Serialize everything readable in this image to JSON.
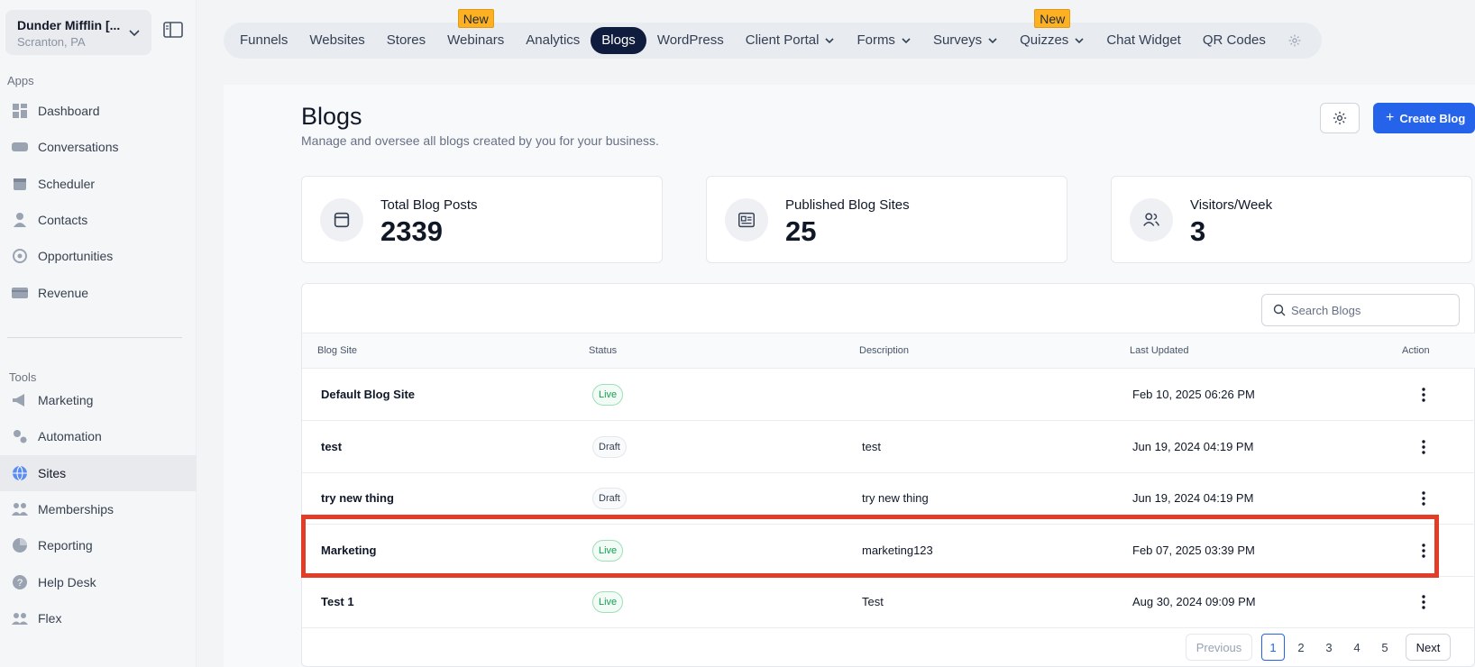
{
  "account": {
    "name": "Dunder Mifflin [...",
    "location": "Scranton, PA"
  },
  "sidebar": {
    "apps_label": "Apps",
    "tools_label": "Tools",
    "apps": [
      {
        "label": "Dashboard",
        "icon": "dashboard-icon"
      },
      {
        "label": "Conversations",
        "icon": "chat-icon"
      },
      {
        "label": "Scheduler",
        "icon": "calendar-icon"
      },
      {
        "label": "Contacts",
        "icon": "person-icon"
      },
      {
        "label": "Opportunities",
        "icon": "target-icon"
      },
      {
        "label": "Revenue",
        "icon": "card-icon"
      }
    ],
    "tools": [
      {
        "label": "Marketing",
        "icon": "megaphone-icon"
      },
      {
        "label": "Automation",
        "icon": "gears-icon"
      },
      {
        "label": "Sites",
        "icon": "globe-icon",
        "active": true
      },
      {
        "label": "Memberships",
        "icon": "people-icon"
      },
      {
        "label": "Reporting",
        "icon": "pie-icon"
      },
      {
        "label": "Help Desk",
        "icon": "help-icon"
      },
      {
        "label": "Flex",
        "icon": "group-icon"
      }
    ]
  },
  "topnav": {
    "tabs": [
      {
        "label": "Funnels"
      },
      {
        "label": "Websites"
      },
      {
        "label": "Stores"
      },
      {
        "label": "Webinars",
        "badge": "New"
      },
      {
        "label": "Analytics"
      },
      {
        "label": "Blogs",
        "active": true
      },
      {
        "label": "WordPress"
      },
      {
        "label": "Client Portal",
        "dropdown": true
      },
      {
        "label": "Forms",
        "dropdown": true
      },
      {
        "label": "Surveys",
        "dropdown": true
      },
      {
        "label": "Quizzes",
        "dropdown": true,
        "badge": "New"
      },
      {
        "label": "Chat Widget"
      },
      {
        "label": "QR Codes"
      }
    ]
  },
  "page": {
    "title": "Blogs",
    "subtitle": "Manage and oversee all blogs created by you for your business.",
    "create_label": "Create Blog"
  },
  "stats": [
    {
      "label": "Total Blog Posts",
      "value": "2339",
      "icon": "calendar-page-icon"
    },
    {
      "label": "Published Blog Sites",
      "value": "25",
      "icon": "article-icon"
    },
    {
      "label": "Visitors/Week",
      "value": "3",
      "icon": "users-icon"
    }
  ],
  "table": {
    "search_placeholder": "Search Blogs",
    "columns": [
      "Blog Site",
      "Status",
      "Description",
      "Last Updated",
      "Action"
    ],
    "rows": [
      {
        "site": "Default Blog Site",
        "status": "Live",
        "description": "",
        "updated": "Feb 10, 2025 06:26 PM"
      },
      {
        "site": "test",
        "status": "Draft",
        "description": "test",
        "updated": "Jun 19, 2024 04:19 PM"
      },
      {
        "site": "try new thing",
        "status": "Draft",
        "description": "try new thing",
        "updated": "Jun 19, 2024 04:19 PM"
      },
      {
        "site": "Marketing",
        "status": "Live",
        "description": "marketing123",
        "updated": "Feb 07, 2025 03:39 PM"
      },
      {
        "site": "Test 1",
        "status": "Live",
        "description": "Test",
        "updated": "Aug 30, 2024 09:09 PM"
      }
    ]
  },
  "pagination": {
    "previous": "Previous",
    "next": "Next",
    "pages": [
      "1",
      "2",
      "3",
      "4",
      "5"
    ],
    "current": "1"
  },
  "colors": {
    "primary": "#2563eb",
    "active_tab": "#101c3d",
    "highlight": "#e23d28",
    "live": "#12a150"
  }
}
